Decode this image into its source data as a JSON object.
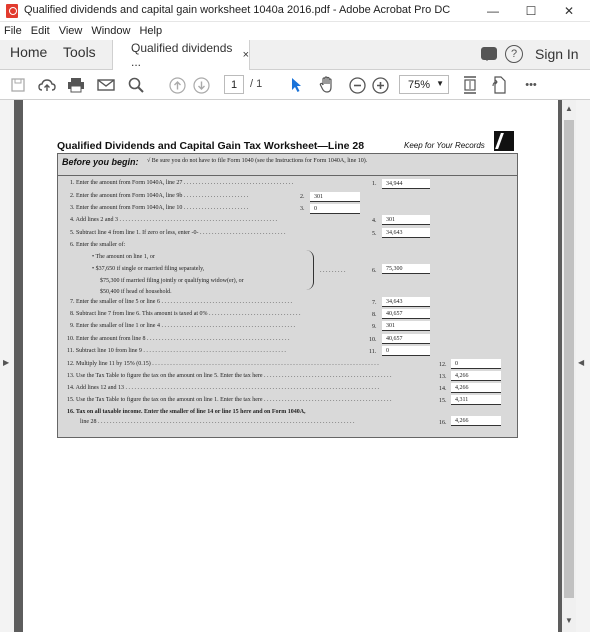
{
  "window": {
    "title": "Qualified dividends and capital gain worksheet 1040a 2016.pdf - Adobe Acrobat Pro DC",
    "minimize": "—",
    "maximize": "☐",
    "close": "✕"
  },
  "menu": [
    "File",
    "Edit",
    "View",
    "Window",
    "Help"
  ],
  "tabs": {
    "home": "Home",
    "tools": "Tools",
    "doc": "Qualified dividends ...",
    "close": "×",
    "help": "?",
    "signin": "Sign In"
  },
  "toolbar": {
    "page_current": "1",
    "page_total": "/ 1",
    "zoom": "75%",
    "more": "•••"
  },
  "worksheet": {
    "title": "Qualified Dividends and Capital Gain Tax Worksheet—Line 28",
    "keep": "Keep for Your Records",
    "before_label": "Before you begin:",
    "before_text": "√  Be sure you do not have to file Form 1040 (see the Instructions for Form 1040A, line 10).",
    "rows": [
      {
        "text": "1.  Enter the amount from Form 1040A, line 27  . . . . . . . . . . . . . . . . . . . . . . . . . . . . . . . . . . . . .",
        "num": "1.",
        "value": "34,944"
      },
      {
        "text": "2.  Enter the amount from Form 1040A, line 9b  . . . . . . . . . . . . . . . . . . . . . .",
        "num": "2.",
        "value": "301"
      },
      {
        "text": "3.  Enter the amount from Form 1040A, line 10  . . . . . . . . . . . . . . . . . . . . . .",
        "num": "3.",
        "value": "0"
      },
      {
        "text": "4.  Add lines 2 and 3  . . . . . . . . . . . . . . . . . . . . . . . . . . . . . . . . . . . . . . . . . . . . . . . . . . . . .",
        "num": "4.",
        "value": "301"
      },
      {
        "text": "5.  Subtract line 4 from line 1. If zero or less, enter -0-  . . . . . . . . . . . . . . . . . . . . . . . . . . . . .",
        "num": "5.",
        "value": "34,643"
      },
      {
        "text": "6.  Enter the smaller of:",
        "num": "6.",
        "value": "75,300"
      },
      {
        "text": "7.  Enter the smaller of line 5 or line 6  . . . . . . . . . . . . . . . . . . . . . . . . . . . . . . . . . . . . . . . . . . . .",
        "num": "7.",
        "value": "34,643"
      },
      {
        "text": "8.  Subtract line 7 from line 6. This amount is taxed at 0%  . . . . . . . . . . . . . . . . . . . . . . . . . . . . . . .",
        "num": "8.",
        "value": "40,657"
      },
      {
        "text": "9.  Enter the smaller of line 1 or line 4  . . . . . . . . . . . . . . . . . . . . . . . . . . . . . . . . . . . . . . . . . . . . .",
        "num": "9.",
        "value": "301"
      },
      {
        "text": "10.  Enter the amount from line 8  . . . . . . . . . . . . . . . . . . . . . . . . . . . . . . . . . . . . . . . . . . . . . . . .",
        "num": "10.",
        "value": "40,657"
      },
      {
        "text": "11.  Subtract line 10 from line 9  . . . . . . . . . . . . . . . . . . . . . . . . . . . . . . . . . . . . . . . . . . . . . . . .",
        "num": "11.",
        "value": "0"
      },
      {
        "text": "12.  Multiply line 11 by 15% (0.15)  . . . . . . . . . . . . . . . . . . . . . . . . . . . . . . . . . . . . . . . . . . . . . . . . . . . . . . . . . . . . . . . . . . . . . . . . . . . .",
        "num": "12.",
        "value": "0"
      },
      {
        "text": "13.  Use the Tax Table to figure the tax on the amount on line 5. Enter the tax here  . . . . . . . . . . . . . . . . . . . . . . . . . . . . . . . . . . . . . . . . . . .",
        "num": "13.",
        "value": "4,266"
      },
      {
        "text": "14.  Add lines 12 and 13  . . . . . . . . . . . . . . . . . . . . . . . . . . . . . . . . . . . . . . . . . . . . . . . . . . . . . . . . . . . . . . . . . . . . . . . . . . . . . . . . . . . . .",
        "num": "14.",
        "value": "4,266"
      },
      {
        "text": "15.  Use the Tax Table to figure the tax on the amount on line 1. Enter the tax here  . . . . . . . . . . . . . . . . . . . . . . . . . . . . . . . . . . . . . . . . . . .",
        "num": "15.",
        "value": "4,311"
      },
      {
        "text": "16.  Tax on all taxable income. Enter the smaller of line 14 or line 15 here and on Form 1040A,",
        "num": "16.",
        "value": "4,266"
      }
    ],
    "line6_opts": [
      "• The amount on line 1, or",
      "• $37,650 if single or married filing separately,",
      "$75,300 if married filing jointly or qualifying widow(er), or",
      "$50,400 if head of household."
    ],
    "line16_cont": "line 28  . . . . . . . . . . . . . . . . . . . . . . . . . . . . . . . . . . . . . . . . . . . . . . . . . . . . . . . . . . . . . . . . . . . . . . . . . . . . . . . . . . . . . ."
  }
}
